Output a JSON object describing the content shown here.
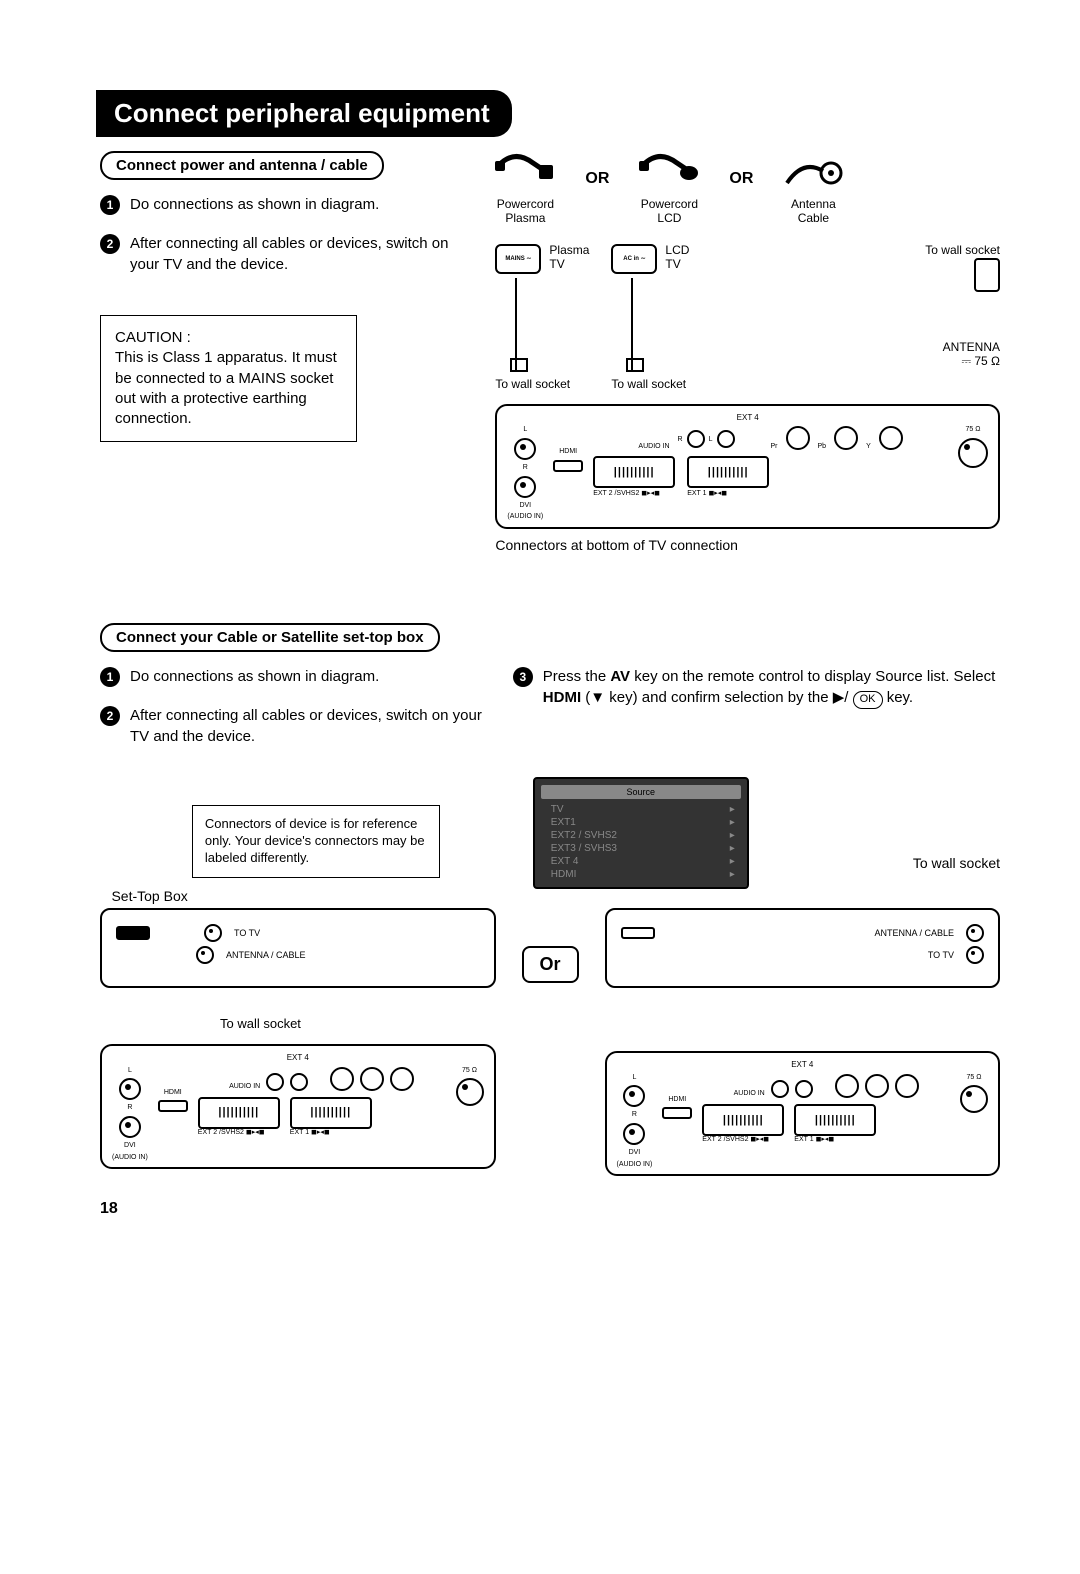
{
  "title": "Connect peripheral equipment",
  "page_number": "18",
  "section1": {
    "heading": "Connect power and antenna / cable",
    "step1": "Do connections as shown in diagram.",
    "step2": "After connecting all cables or devices, switch on your TV and the device.",
    "caution_label": "CAUTION :",
    "caution_text": "This is Class 1 apparatus. It must be connected to a MAINS socket out with a protective earthing connection."
  },
  "cables": {
    "or": "OR",
    "item1a": "Powercord",
    "item1b": "Plasma",
    "item2a": "Powercord",
    "item2b": "LCD",
    "item3a": "Antenna",
    "item3b": "Cable"
  },
  "plugs": {
    "mains": "MAINS ∼",
    "acin": "AC in ∼",
    "plasma": "Plasma TV",
    "lcd": "LCD TV",
    "to_wall": "To wall socket",
    "antenna": "ANTENNA",
    "ohm": "⎓ 75 Ω"
  },
  "panel": {
    "ext4": "EXT 4",
    "audio_in": "AUDIO IN",
    "r": "R",
    "l": "L",
    "pr": "Pr",
    "pb": "Pb",
    "y": "Y",
    "ohm": "75 Ω",
    "hdmi": "HDMI",
    "dvi": "DVI",
    "audio_in_sub": "(AUDIO IN)",
    "ext2": "EXT 2 /SVHS2 ◼▸◂◼",
    "ext1": "EXT 1  ◼▸◂◼",
    "caption": "Connectors at bottom of TV connection"
  },
  "section2": {
    "heading": "Connect your Cable or Satellite set-top box",
    "step1": "Do connections as shown in diagram.",
    "step2": "After connecting all cables or devices, switch on your TV and the device.",
    "step3a": "Press the ",
    "step3_av": "AV",
    "step3b": " key on the remote control to display Source list. Select ",
    "step3_hdmi": "HDMI",
    "step3c": " (▼ key) and confirm selection by the ▶/ ",
    "step3_ok": "OK",
    "step3d": " key.",
    "note": "Connectors of device is for reference only. Your device's connectors may be labeled differently.",
    "stb_label": "Set-Top Box",
    "or_box": "Or"
  },
  "source_menu": {
    "title": "Source",
    "items": [
      "TV",
      "EXT1",
      "EXT2 / SVHS2",
      "EXT3 / SVHS3",
      "EXT 4",
      "HDMI"
    ]
  },
  "stb": {
    "to_tv": "TO TV",
    "ant_cable": "ANTENNA / CABLE",
    "to_wall": "To wall socket"
  }
}
